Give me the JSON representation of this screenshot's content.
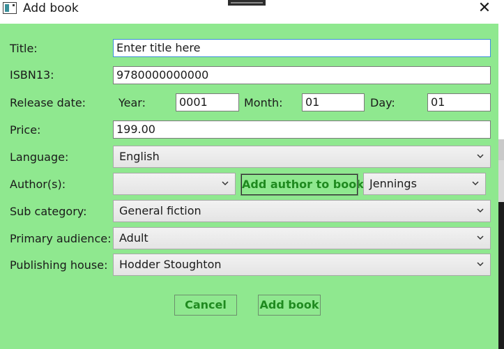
{
  "window": {
    "title": "Add book",
    "close_glyph": "✕",
    "icon": "app-window-icon"
  },
  "form": {
    "title": {
      "label": "Title:",
      "value": "Enter title here"
    },
    "isbn": {
      "label": "ISBN13:",
      "value": "9780000000000"
    },
    "release": {
      "label": "Release date:",
      "year_label": "Year:",
      "year_value": "0001",
      "month_label": "Month:",
      "month_value": "01",
      "day_label": "Day:",
      "day_value": "01"
    },
    "price": {
      "label": "Price:",
      "value": "199.00"
    },
    "language": {
      "label": "Language:",
      "value": "English"
    },
    "authors": {
      "label": "Author(s):",
      "selected": "",
      "add_button": "Add author to book",
      "author_value": "Jennings"
    },
    "sub_category": {
      "label": "Sub category:",
      "value": "General fiction"
    },
    "audience": {
      "label": "Primary audience:",
      "value": "Adult"
    },
    "publisher": {
      "label": "Publishing house:",
      "value": "Hodder Stoughton"
    }
  },
  "actions": {
    "cancel": "Cancel",
    "add_book": "Add book"
  },
  "colors": {
    "background": "#8fe88f",
    "button_text": "#1f8a1f",
    "focus_border": "#3c8dd8"
  }
}
